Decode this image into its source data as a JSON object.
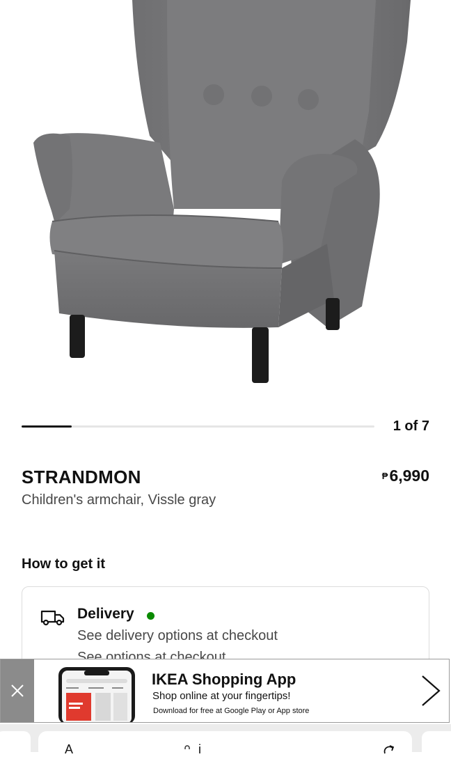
{
  "gallery": {
    "image_alt": "STRANDMON children's armchair in Vissle gray",
    "counter": "1 of 7",
    "current": 1,
    "total": 7
  },
  "product": {
    "name": "STRANDMON",
    "description": "Children's armchair, Vissle gray",
    "price_currency": "₱",
    "price_value": "6,990"
  },
  "fulfillment": {
    "heading": "How to get it",
    "delivery": {
      "icon": "truck-icon",
      "title": "Delivery",
      "status_color": "#0a8a00",
      "line1": "See delivery options at checkout",
      "line2": "See options at checkout"
    }
  },
  "app_banner": {
    "title": "IKEA Shopping App",
    "subtitle": "Shop online at your fingertips!",
    "small": "Download for free at Google Play or App store",
    "close_icon": "close-icon",
    "chevron_icon": "chevron-right-icon"
  },
  "browser_bar": {
    "left_glyph": "A",
    "url_fragment": "i",
    "refresh_icon": "refresh-icon"
  },
  "colors": {
    "chair": "#7b7b7d",
    "accent_dark": "#111111",
    "in_stock": "#0a8a00"
  }
}
